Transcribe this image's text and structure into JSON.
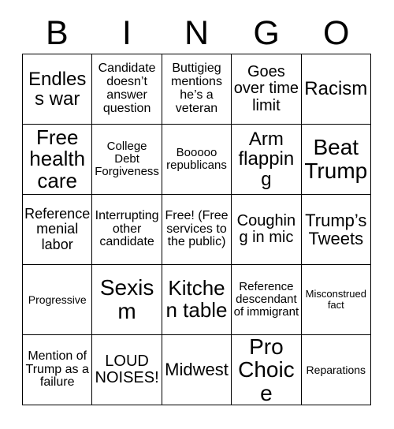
{
  "card": {
    "header_letters": [
      "B",
      "I",
      "N",
      "G",
      "O"
    ],
    "grid_size": "5x5",
    "colors": {
      "background": "#ffffff",
      "text": "#000000",
      "border": "#000000"
    },
    "columns": {
      "B": [
        "Endless war",
        "Free health care",
        "Reference menial labor",
        "Progressive",
        "Mention of Trump as a failure"
      ],
      "I": [
        "Candidate doesn’t answer question",
        "College Debt Forgiveness",
        "Interrupting other candidate",
        "Sexism",
        "LOUD NOISES!"
      ],
      "N": [
        "Buttigieg mentions he’s a veteran",
        "Booooo republicans",
        "Free! (Free services to the public)",
        "Kitchen table",
        "Midwest"
      ],
      "G": [
        "Goes over time limit",
        "Arm flapping",
        "Coughing in mic",
        "Reference descendant of immigrant",
        "Pro Choice"
      ],
      "O": [
        "Racism",
        "Beat Trump",
        "Trump’s Tweets",
        "Misconstrued fact",
        "Reparations"
      ]
    },
    "cells": [
      {
        "row": 1,
        "col": 1,
        "column_letter": "B",
        "text": "Endless war",
        "size_class": "fs-24"
      },
      {
        "row": 1,
        "col": 2,
        "column_letter": "I",
        "text": "Candidate doesn’t answer question",
        "size_class": "fs-16"
      },
      {
        "row": 1,
        "col": 3,
        "column_letter": "N",
        "text": "Buttigieg mentions he’s a veteran",
        "size_class": "fs-16"
      },
      {
        "row": 1,
        "col": 4,
        "column_letter": "G",
        "text": "Goes over time limit",
        "size_class": "fs-20"
      },
      {
        "row": 1,
        "col": 5,
        "column_letter": "O",
        "text": "Racism",
        "size_class": "fs-24"
      },
      {
        "row": 2,
        "col": 1,
        "column_letter": "B",
        "text": "Free health care",
        "size_class": "fs-26"
      },
      {
        "row": 2,
        "col": 2,
        "column_letter": "I",
        "text": "College Debt Forgiveness",
        "size_class": "fs-15"
      },
      {
        "row": 2,
        "col": 3,
        "column_letter": "N",
        "text": "Booooo republicans",
        "size_class": "fs-15"
      },
      {
        "row": 2,
        "col": 4,
        "column_letter": "G",
        "text": "Arm flapping",
        "size_class": "fs-24"
      },
      {
        "row": 2,
        "col": 5,
        "column_letter": "O",
        "text": "Beat Trump",
        "size_class": "fs-28"
      },
      {
        "row": 3,
        "col": 1,
        "column_letter": "B",
        "text": "Reference menial labor",
        "size_class": "fs-18"
      },
      {
        "row": 3,
        "col": 2,
        "column_letter": "I",
        "text": "Interrupting other candidate",
        "size_class": "fs-16"
      },
      {
        "row": 3,
        "col": 3,
        "column_letter": "N",
        "text": "Free! (Free services to the public)",
        "size_class": "fs-16"
      },
      {
        "row": 3,
        "col": 4,
        "column_letter": "G",
        "text": "Coughing in mic",
        "size_class": "fs-20"
      },
      {
        "row": 3,
        "col": 5,
        "column_letter": "O",
        "text": "Trump’s Tweets",
        "size_class": "fs-22"
      },
      {
        "row": 4,
        "col": 1,
        "column_letter": "B",
        "text": "Progressive",
        "size_class": "fs-14"
      },
      {
        "row": 4,
        "col": 2,
        "column_letter": "I",
        "text": "Sexism",
        "size_class": "fs-28"
      },
      {
        "row": 4,
        "col": 3,
        "column_letter": "N",
        "text": "Kitchen table",
        "size_class": "fs-26"
      },
      {
        "row": 4,
        "col": 4,
        "column_letter": "G",
        "text": "Reference descendant of immigrant",
        "size_class": "fs-15"
      },
      {
        "row": 4,
        "col": 5,
        "column_letter": "O",
        "text": "Misconstrued fact",
        "size_class": "fs-13"
      },
      {
        "row": 5,
        "col": 1,
        "column_letter": "B",
        "text": "Mention of Trump as a failure",
        "size_class": "fs-16"
      },
      {
        "row": 5,
        "col": 2,
        "column_letter": "I",
        "text": "LOUD NOISES!",
        "size_class": "fs-20"
      },
      {
        "row": 5,
        "col": 3,
        "column_letter": "N",
        "text": "Midwest",
        "size_class": "fs-22"
      },
      {
        "row": 5,
        "col": 4,
        "column_letter": "G",
        "text": "Pro Choice",
        "size_class": "fs-28"
      },
      {
        "row": 5,
        "col": 5,
        "column_letter": "O",
        "text": "Reparations",
        "size_class": "fs-14"
      }
    ]
  }
}
